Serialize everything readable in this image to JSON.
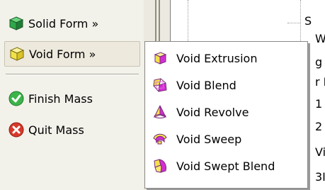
{
  "panel": {
    "solid_form": {
      "label": "Solid Form »",
      "icon": "solid-form-cube-icon"
    },
    "void_form": {
      "label": "Void Form »",
      "icon": "void-form-cube-icon"
    },
    "finish_mass": {
      "label": "Finish Mass",
      "icon": "green-check-icon"
    },
    "quit_mass": {
      "label": "Quit Mass",
      "icon": "red-x-icon"
    }
  },
  "void_menu": {
    "items": [
      {
        "label": "Void Extrusion",
        "icon": "void-extrusion-icon"
      },
      {
        "label": "Void Blend",
        "icon": "void-blend-icon"
      },
      {
        "label": "Void Revolve",
        "icon": "void-revolve-icon"
      },
      {
        "label": "Void Sweep",
        "icon": "void-sweep-icon"
      },
      {
        "label": "Void Swept Blend",
        "icon": "void-swept-blend-icon"
      }
    ]
  },
  "tree": {
    "fragments": [
      "S",
      "W",
      "g",
      "r I",
      "1",
      "2",
      "Vi",
      "3I"
    ]
  },
  "colors": {
    "panel_bg": "#f2f1ea",
    "void_yellow": "#f2e24a",
    "void_magenta": "#d22fd2",
    "solid_green": "#2fa84a",
    "check_green": "#3cb44a",
    "quit_red": "#d63a2a"
  }
}
